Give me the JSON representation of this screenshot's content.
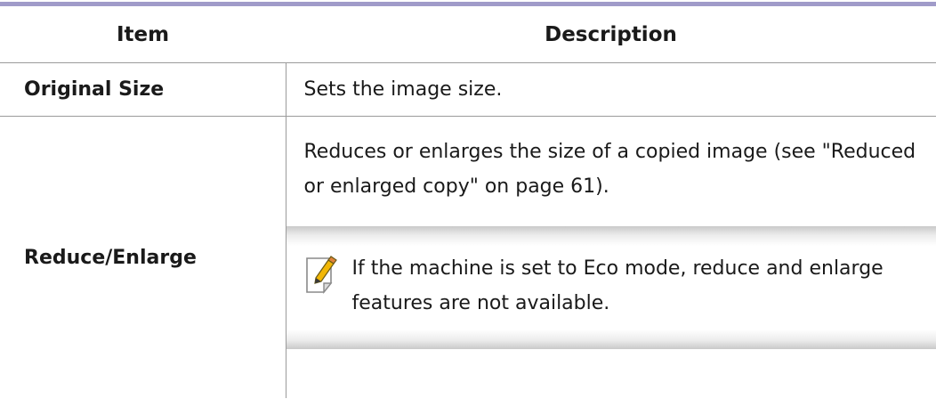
{
  "table": {
    "headers": {
      "item": "Item",
      "description": "Description"
    },
    "rows": [
      {
        "item": "Original Size",
        "description": "Sets the image size."
      },
      {
        "item": "Reduce/Enlarge",
        "description": "Reduces or enlarges the size of a copied image (see \"Reduced or enlarged copy\" on page 61).",
        "note": {
          "icon": "note-pencil-icon",
          "text": "If the machine is set to Eco mode, reduce and enlarge features are not available."
        }
      }
    ]
  },
  "colors": {
    "top_rule": "#a09bc9",
    "borders": "#9b9b9b",
    "note_icon_accent": "#f2b705"
  }
}
